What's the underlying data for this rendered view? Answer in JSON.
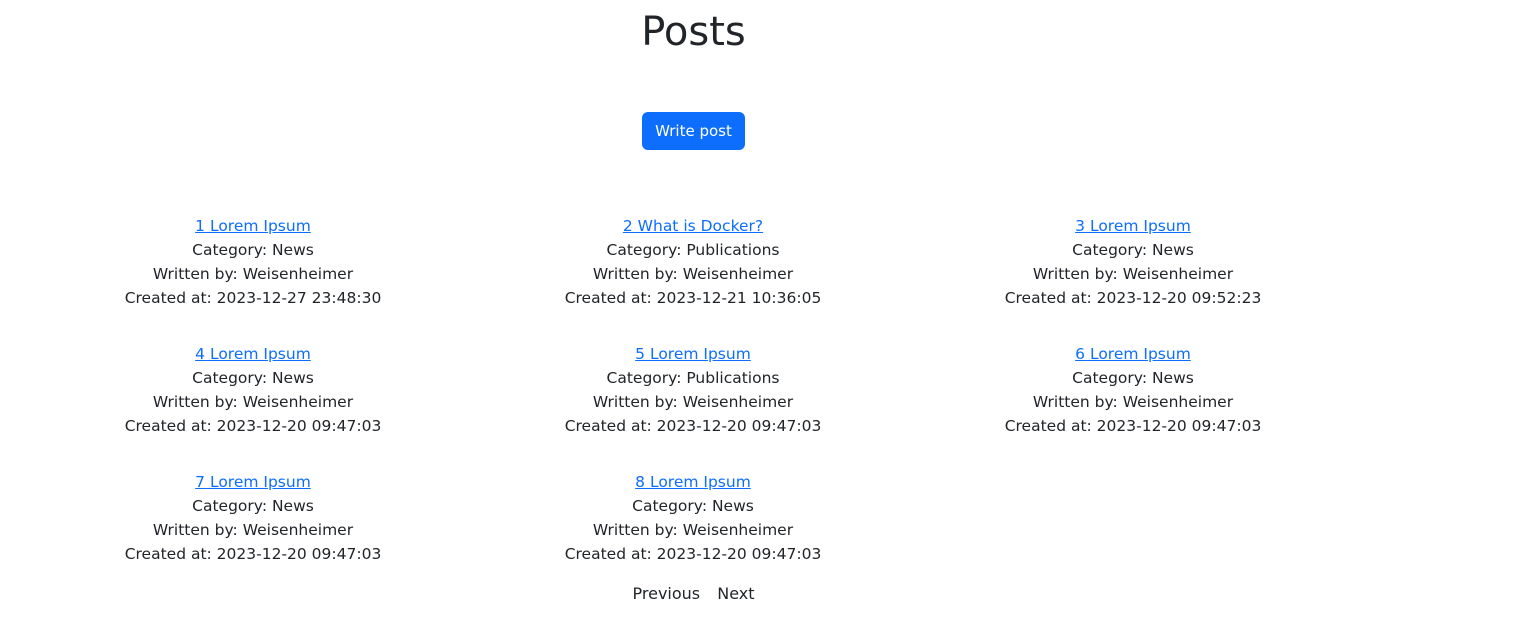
{
  "header": {
    "title": "Posts"
  },
  "actions": {
    "write_post_label": "Write post"
  },
  "posts": [
    {
      "title": "1 Lorem Ipsum",
      "category": "Category: News",
      "author": "Written by: Weisenheimer",
      "created": "Created at: 2023-12-27 23:48:30"
    },
    {
      "title": "2 What is Docker?",
      "category": "Category: Publications",
      "author": "Written by: Weisenheimer",
      "created": "Created at: 2023-12-21 10:36:05"
    },
    {
      "title": "3 Lorem Ipsum",
      "category": "Category: News",
      "author": "Written by: Weisenheimer",
      "created": "Created at: 2023-12-20 09:52:23"
    },
    {
      "title": "4 Lorem Ipsum",
      "category": "Category: News",
      "author": "Written by: Weisenheimer",
      "created": "Created at: 2023-12-20 09:47:03"
    },
    {
      "title": "5 Lorem Ipsum",
      "category": "Category: Publications",
      "author": "Written by: Weisenheimer",
      "created": "Created at: 2023-12-20 09:47:03"
    },
    {
      "title": "6 Lorem Ipsum",
      "category": "Category: News",
      "author": "Written by: Weisenheimer",
      "created": "Created at: 2023-12-20 09:47:03"
    },
    {
      "title": "7 Lorem Ipsum",
      "category": "Category: News",
      "author": "Written by: Weisenheimer",
      "created": "Created at: 2023-12-20 09:47:03"
    },
    {
      "title": "8 Lorem Ipsum",
      "category": "Category: News",
      "author": "Written by: Weisenheimer",
      "created": "Created at: 2023-12-20 09:47:03"
    }
  ],
  "pagination": {
    "previous_label": "Previous",
    "next_label": "Next"
  },
  "colors": {
    "accent": "#0d6efd",
    "text": "#212529",
    "background": "#ffffff"
  }
}
